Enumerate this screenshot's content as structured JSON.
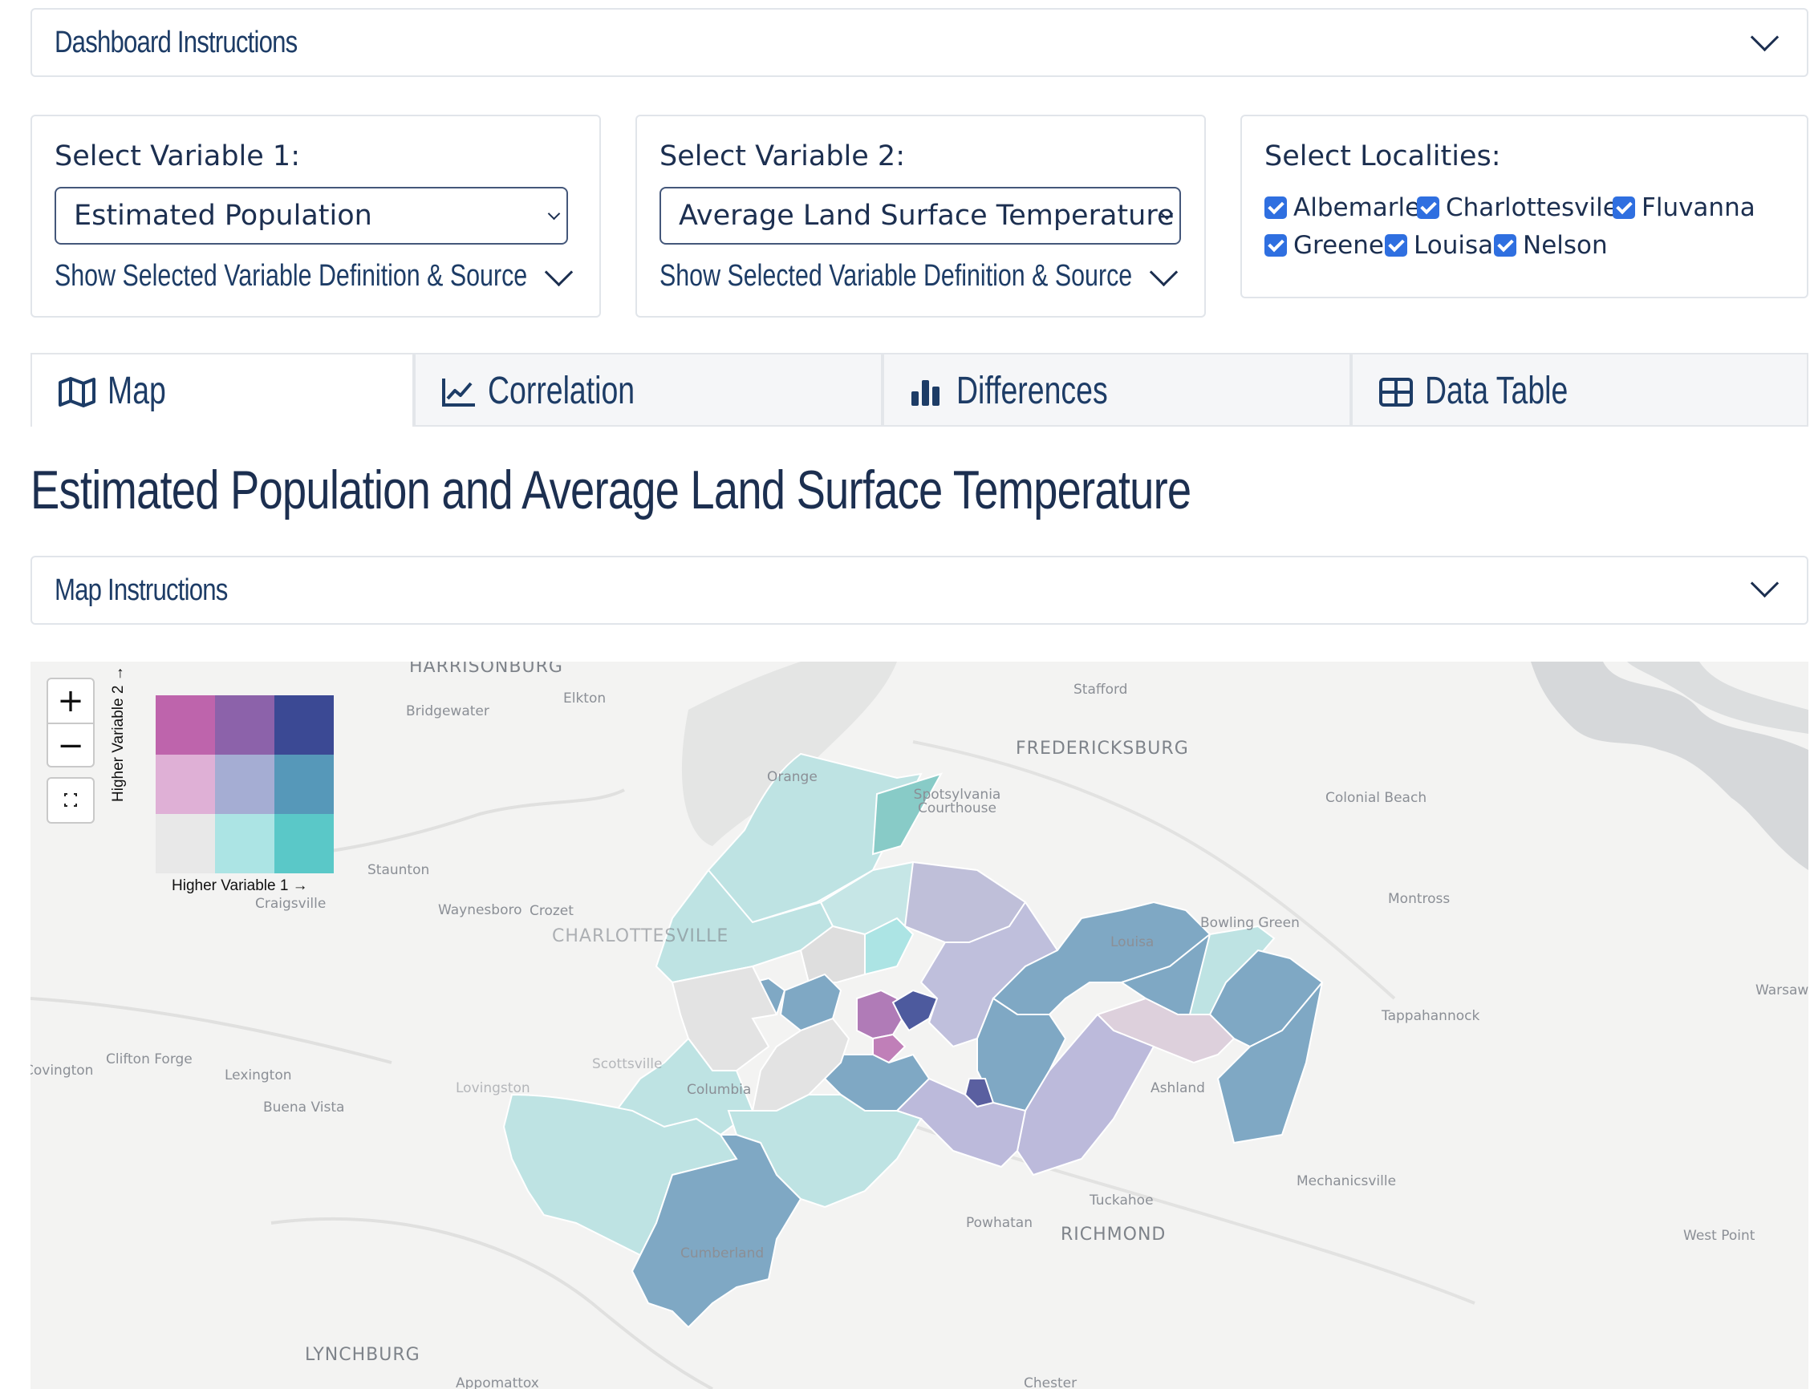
{
  "dashboard_instructions": {
    "label": "Dashboard Instructions"
  },
  "variable1": {
    "label": "Select Variable 1:",
    "selected": "Estimated Population",
    "definition_toggle": "Show Selected Variable Definition & Source"
  },
  "variable2": {
    "label": "Select Variable 2:",
    "selected": "Average Land Surface Temperature",
    "definition_toggle": "Show Selected Variable Definition & Source"
  },
  "localities": {
    "label": "Select Localities:",
    "items": [
      {
        "label": "Albemarle",
        "checked": true
      },
      {
        "label": "Charlottesvile",
        "checked": true
      },
      {
        "label": "Fluvanna",
        "checked": true
      },
      {
        "label": "Greene",
        "checked": true
      },
      {
        "label": "Louisa",
        "checked": true
      },
      {
        "label": "Nelson",
        "checked": true
      }
    ]
  },
  "tabs": [
    {
      "label": "Map",
      "icon": "map-icon",
      "active": true
    },
    {
      "label": "Correlation",
      "icon": "line-chart-icon",
      "active": false
    },
    {
      "label": "Differences",
      "icon": "bar-chart-icon",
      "active": false
    },
    {
      "label": "Data Table",
      "icon": "table-icon",
      "active": false
    }
  ],
  "map_title": "Estimated Population and Average Land Surface Temperature",
  "map_instructions": {
    "label": "Map Instructions"
  },
  "map": {
    "zoom_in": "+",
    "zoom_out": "−",
    "legend": {
      "x_label": "Higher Variable 1 →",
      "y_label": "Higher Variable 2 →",
      "colors": [
        [
          "#be64ac",
          "#8c62aa",
          "#3b4994"
        ],
        [
          "#dfb0d6",
          "#a5add3",
          "#5698b9"
        ],
        [
          "#e8e8e8",
          "#ace4e4",
          "#5ac8c8"
        ]
      ]
    },
    "places": [
      "HARRISONBURG",
      "Bridgewater",
      "Elkton",
      "Stafford",
      "FREDERICKSBURG",
      "Orange",
      "Colonial Beach",
      "Spotsylvania Courthouse",
      "Staunton",
      "Craigsville",
      "Waynesboro",
      "Crozet",
      "CHARLOTTESVILLE",
      "Louisa",
      "Montross",
      "Bowling Green",
      "Tappahannock",
      "Clifton Forge",
      "Covington",
      "Lexington",
      "Buena Vista",
      "Lovingston",
      "Scottsville",
      "Columbia",
      "Ashland",
      "Mechanicsville",
      "Tuckahoe",
      "RICHMOND",
      "Powhatan",
      "Cumberland",
      "LYNCHBURG",
      "West Point",
      "Warsaw",
      "Appomattox",
      "Chester"
    ]
  }
}
